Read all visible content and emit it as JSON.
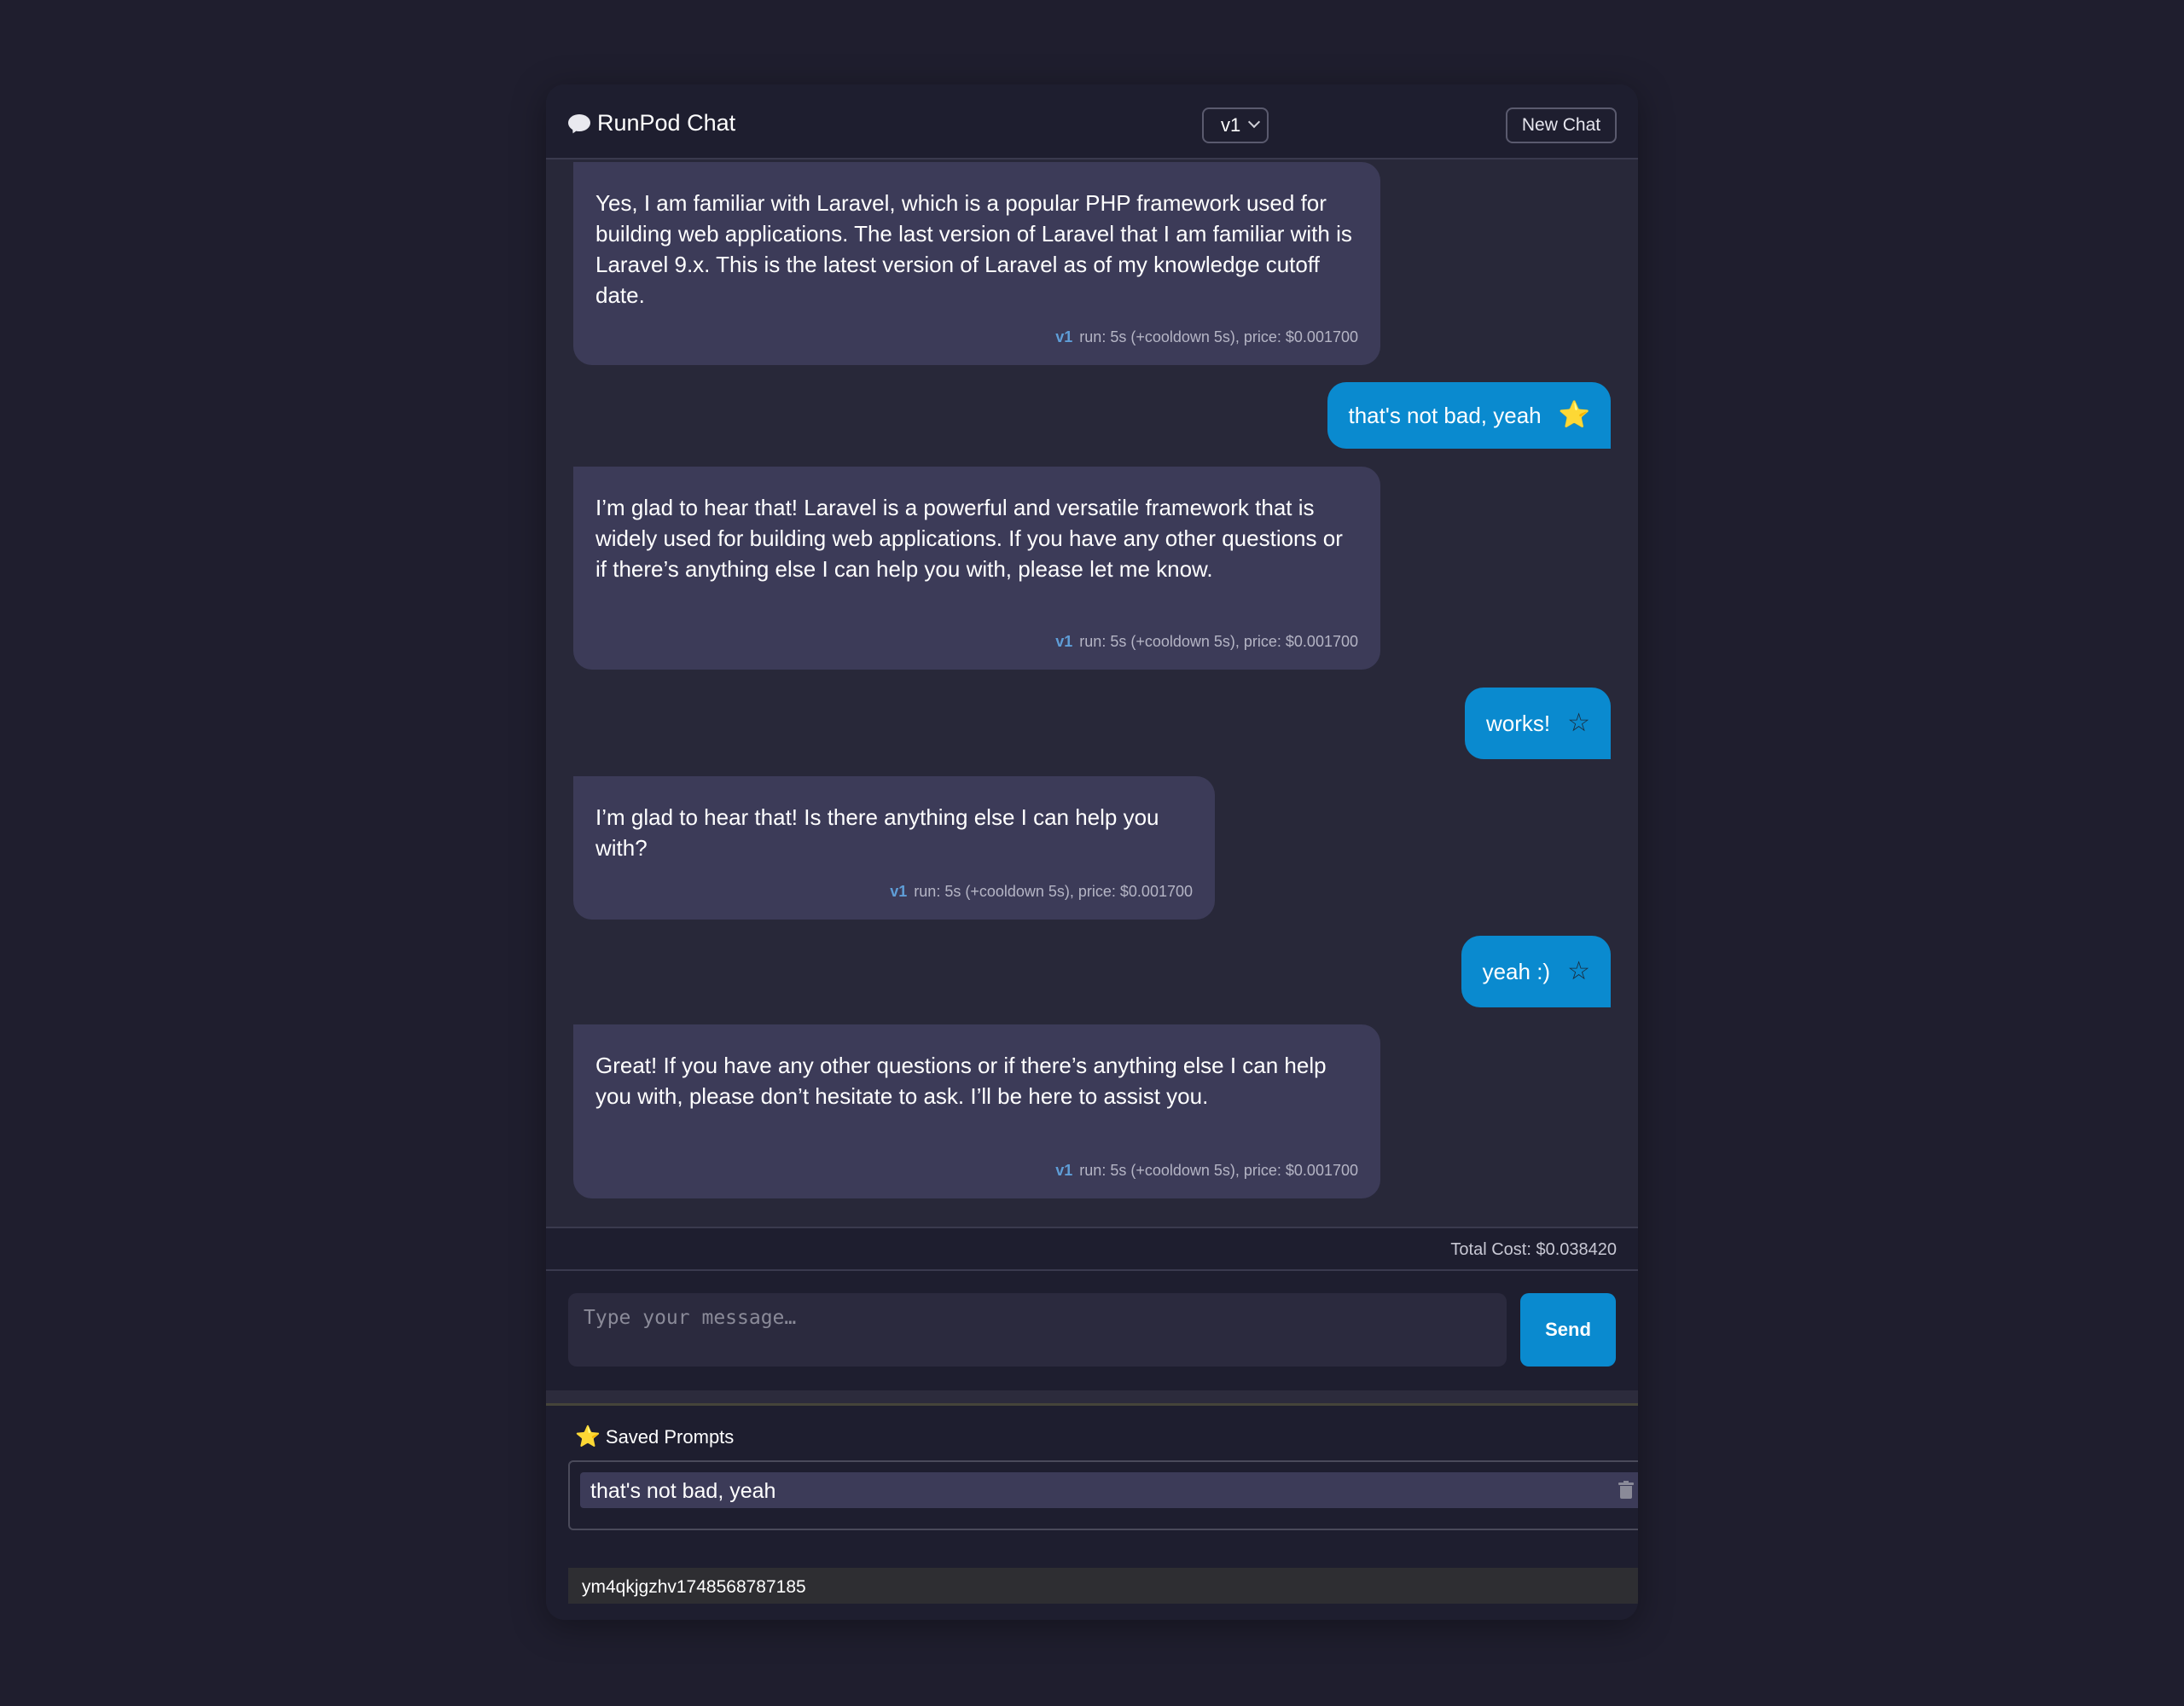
{
  "header": {
    "title": "RunPod Chat",
    "chat_icon": "speech-bubble-icon",
    "version_selected": "v1",
    "new_chat_label": "New Chat"
  },
  "messages": [
    {
      "role": "assistant",
      "text": "Yes, I am familiar with Laravel, which is a popular PHP framework used for building web applications. The last version of Laravel that I am familiar with is Laravel 9.x. This is the latest version of Laravel as of my knowledge cutoff date.",
      "version": "v1",
      "meta": "run: 5s (+cooldown 5s), price: $0.001700"
    },
    {
      "role": "user",
      "text": "that's not bad, yeah",
      "starred": true,
      "star_glyph": "⭐"
    },
    {
      "role": "assistant",
      "text": "I’m glad to hear that! Laravel is a powerful and versatile framework that is widely used for building web applications. If you have any other questions or if there’s anything else I can help you with, please let me know.",
      "version": "v1",
      "meta": "run: 5s (+cooldown 5s), price: $0.001700"
    },
    {
      "role": "user",
      "text": "works!",
      "starred": false,
      "star_glyph": "☆"
    },
    {
      "role": "assistant",
      "text": "I’m glad to hear that! Is there anything else I can help you with?",
      "version": "v1",
      "meta": "run: 5s (+cooldown 5s), price: $0.001700"
    },
    {
      "role": "user",
      "text": "yeah :)",
      "starred": false,
      "star_glyph": "☆"
    },
    {
      "role": "assistant",
      "text": "Great! If you have any other questions or if there’s anything else I can help you with, please don’t hesitate to ask. I’ll be here to assist you.",
      "version": "v1",
      "meta": "run: 5s (+cooldown 5s), price: $0.001700"
    }
  ],
  "total_cost": "Total Cost: $0.038420",
  "composer": {
    "placeholder": "Type your message…",
    "value": "",
    "send_label": "Send"
  },
  "saved_prompts": {
    "title": "Saved Prompts",
    "star_glyph": "⭐",
    "items": [
      {
        "label": "that's not bad, yeah",
        "icon": "trash-icon"
      }
    ]
  },
  "session_id": "ym4qkjgzhv1748568787185",
  "colors": {
    "page_bg": "#1f1e2e",
    "panel_bg": "#282839",
    "assistant_bubble": "#3c3b58",
    "user_bubble": "#0a8acf",
    "accent": "#0a8acf",
    "version_tag": "#5f9ed8",
    "star": "#f7c948"
  }
}
